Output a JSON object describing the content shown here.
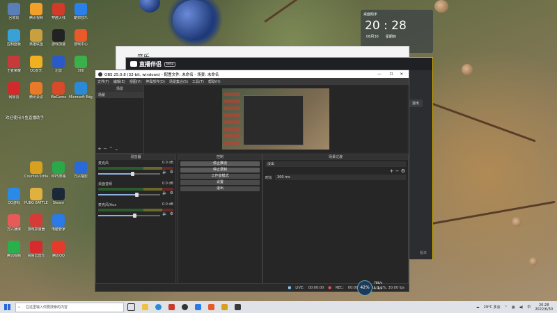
{
  "desktop_icons": [
    {
      "label": "回收站",
      "color": "#5a7fb8",
      "col": 0,
      "row": 0
    },
    {
      "label": "腾讯视频",
      "color": "#f2a02a",
      "col": 1,
      "row": 0
    },
    {
      "label": "穿越火线",
      "color": "#d23a2a",
      "col": 2,
      "row": 0
    },
    {
      "label": "酷狗音乐",
      "color": "#2a7fe8",
      "col": 3,
      "row": 0
    },
    {
      "label": "控制面板",
      "color": "#3aa0d8",
      "col": 0,
      "row": 1
    },
    {
      "label": "英雄联盟",
      "color": "#c8a040",
      "col": 1,
      "row": 1
    },
    {
      "label": "游戏加速",
      "color": "#222222",
      "col": 2,
      "row": 1
    },
    {
      "label": "游戏中心",
      "color": "#e85a2a",
      "col": 3,
      "row": 1
    },
    {
      "label": "王者荣耀",
      "color": "#c83a3a",
      "col": 0,
      "row": 2
    },
    {
      "label": "QQ音乐",
      "color": "#f0b020",
      "col": 1,
      "row": 2
    },
    {
      "label": "迅雷",
      "color": "#2a5ac8",
      "col": 2,
      "row": 2
    },
    {
      "label": "360",
      "color": "#3ab04a",
      "col": 3,
      "row": 2
    },
    {
      "label": "网易云",
      "color": "#d22a2a",
      "col": 0,
      "row": 3
    },
    {
      "label": "腾讯会议",
      "color": "#e87a2a",
      "col": 1,
      "row": 3
    },
    {
      "label": "WeGame",
      "color": "#d84a2a",
      "col": 2,
      "row": 3
    },
    {
      "label": "Microsoft Edge",
      "color": "#2a8ad8",
      "col": 3,
      "row": 3
    },
    {
      "label": "Counter-Strike Global",
      "color": "#d8a020",
      "col": 1,
      "row": 6
    },
    {
      "label": "WPS表格",
      "color": "#2aa84a",
      "col": 2,
      "row": 6
    },
    {
      "label": "万兴喵影",
      "color": "#2a6ad8",
      "col": 3,
      "row": 6
    },
    {
      "label": "QQ游戏",
      "color": "#2a8ae8",
      "col": 0,
      "row": 7
    },
    {
      "label": "PUBG BATTLEG...",
      "color": "#e0b040",
      "col": 1,
      "row": 7
    },
    {
      "label": "Steam",
      "color": "#1b2838",
      "col": 2,
      "row": 7
    },
    {
      "label": "万兴播爆",
      "color": "#e85a5a",
      "col": 0,
      "row": 8
    },
    {
      "label": "游戏加速器",
      "color": "#d83a3a",
      "col": 1,
      "row": 8
    },
    {
      "label": "电脑管家",
      "color": "#2a7ae8",
      "col": 2,
      "row": 8
    },
    {
      "label": "腾讯视频",
      "color": "#2ab04a",
      "col": 0,
      "row": 9
    },
    {
      "label": "网易云音乐",
      "color": "#d82a2a",
      "col": 1,
      "row": 9
    },
    {
      "label": "腾讯QQ",
      "color": "#e83a2a",
      "col": 2,
      "row": 9
    }
  ],
  "desktop_notice": "欢迎使用斗鱼直播助手",
  "clock_widget": {
    "title": "桌面助手",
    "time": "20 : 28",
    "date": "06月30",
    "weekday": "星期四"
  },
  "background_app": {
    "title": "音乐"
  },
  "zhibo_app": {
    "title": "直播伴侣",
    "badge": "Beta",
    "button": "退出",
    "footer": "版本"
  },
  "obs": {
    "title": "OBS 25.0.8 (32-bit, windows) - 配置文件: 未命名 - 场景: 未命名",
    "window_controls": [
      "—",
      "☐",
      "✕"
    ],
    "menu": [
      "文件(F)",
      "编辑(E)",
      "视图(V)",
      "停靠部件(D)",
      "场景集合(S)",
      "工具(T)",
      "帮助(H)"
    ],
    "scenes_header": "场景",
    "scenes": [
      "场景"
    ],
    "mixer_header": "混音器",
    "mixer": [
      {
        "name": "麦克风",
        "db": "0.0 dB",
        "level": 0.55
      },
      {
        "name": "桌面音频",
        "db": "0.0 dB",
        "level": 0.62
      },
      {
        "name": "麦克风/Aux",
        "db": "0.0 dB",
        "level": 0.58
      }
    ],
    "controls_header": "控制",
    "controls": [
      "停止推流",
      "停止录制",
      "工作室模式",
      "设置",
      "退出"
    ],
    "transition_header": "场景过渡",
    "transition_type": "淡出",
    "duration_label": "时长",
    "duration_value": "300 ms",
    "status": {
      "live_label": "LIVE:",
      "live_time": "00:00:00",
      "rec_label": "REC:",
      "rec_time": "00:00:00",
      "cpu": "CPU: 3.2%, 30.00 fps"
    },
    "overlay": {
      "percent": "42%",
      "up": "78k/s",
      "down": "67k/s"
    }
  },
  "taskbar": {
    "search_placeholder": "在这里输入你要搜索的内容",
    "weather": "29°C 多云",
    "time": "20:28",
    "date": "2022/6/30"
  }
}
